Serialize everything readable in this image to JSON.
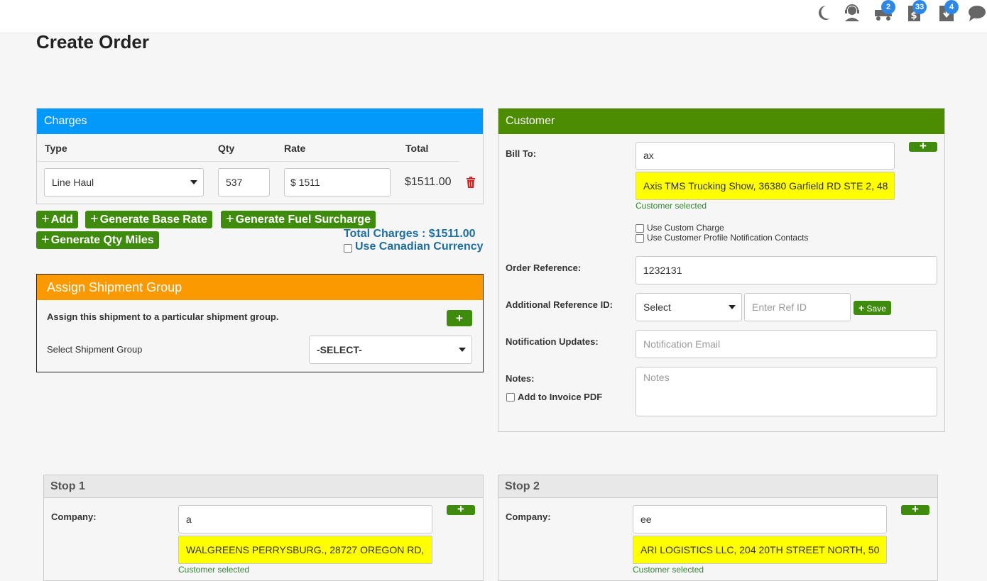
{
  "header": {
    "icons": {
      "theme": "moon-icon",
      "support": "support-agent-icon",
      "dispatch": "truck-icon",
      "billing": "dollar-document-icon",
      "downloads": "download-icon",
      "chat": "chat-icon"
    },
    "badges": {
      "dispatch": "2",
      "billing": "33",
      "downloads": "4"
    }
  },
  "page": {
    "title": "Create Order"
  },
  "charges": {
    "title": "Charges",
    "columns": {
      "type": "Type",
      "qty": "Qty",
      "rate": "Rate",
      "total": "Total"
    },
    "row": {
      "type": "Line Haul",
      "qty": "537",
      "rate_prefix": "$",
      "rate": "1511",
      "total": "$1511.00"
    },
    "buttons": {
      "add": "Add",
      "base_rate": "Generate Base Rate",
      "fuel": "Generate Fuel Surcharge",
      "qty_miles": "Generate Qty Miles"
    },
    "total_label": "Total Charges : $1511.00",
    "canadian": "Use Canadian Currency",
    "header_color": "#0399fb"
  },
  "shipment_group": {
    "title": "Assign Shipment Group",
    "desc": "Assign this shipment to a particular shipment group.",
    "select_label": "Select Shipment Group",
    "select_value": "-SELECT-",
    "header_color": "#fb9a00"
  },
  "customer": {
    "title": "Customer",
    "header_color": "#4c8c00",
    "bill_to_label": "Bill To:",
    "bill_to_value": "ax",
    "bill_to_suggestion": "Axis TMS Trucking Show, 36380 Garfield RD STE 2, 48",
    "customer_selected": "Customer selected",
    "custom_charge": "Use Custom Charge",
    "profile_contacts": "Use Customer Profile Notification Contacts",
    "order_ref_label": "Order Reference:",
    "order_ref_value": "1232131",
    "add_ref_label": "Additional Reference ID:",
    "add_ref_select": "Select",
    "add_ref_placeholder": "Enter Ref ID",
    "save": "Save",
    "notif_label": "Notification Updates:",
    "notif_placeholder": "Notification Email",
    "notes_label": "Notes:",
    "notes_placeholder": "Notes",
    "invoice_pdf": "Add to Invoice PDF"
  },
  "stops": [
    {
      "title": "Stop 1",
      "company_label": "Company:",
      "company_value": "a",
      "suggestion": "WALGREENS PERRYSBURG., 28727 OREGON RD,",
      "selected": "Customer selected"
    },
    {
      "title": "Stop 2",
      "company_label": "Company:",
      "company_value": "ee",
      "suggestion": "ARI LOGISTICS LLC, 204 20TH STREET NORTH, 50",
      "selected": "Customer selected"
    }
  ]
}
